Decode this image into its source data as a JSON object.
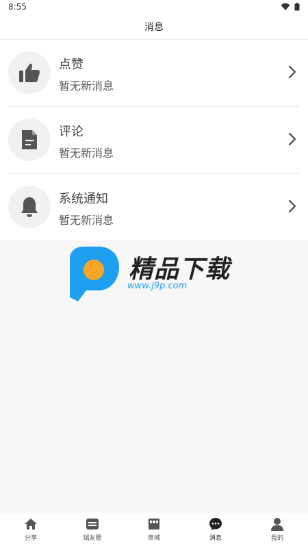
{
  "status": {
    "time": "8:55"
  },
  "header": {
    "title": "消息"
  },
  "rows": [
    {
      "title": "点赞",
      "subtitle": "暂无新消息",
      "icon": "thumbs-up-icon"
    },
    {
      "title": "评论",
      "subtitle": "暂无新消息",
      "icon": "document-icon"
    },
    {
      "title": "系统通知",
      "subtitle": "暂无新消息",
      "icon": "bell-icon"
    }
  ],
  "watermark": {
    "text": "精品下载",
    "url": "www.j9p.com"
  },
  "tabbar": {
    "items": [
      {
        "label": "分享",
        "icon": "home-icon"
      },
      {
        "label": "瑞友圈",
        "icon": "circle-feed-icon"
      },
      {
        "label": "商城",
        "icon": "store-icon"
      },
      {
        "label": "消息",
        "icon": "chat-bubble-icon",
        "active": true
      },
      {
        "label": "我的",
        "icon": "profile-icon"
      }
    ]
  },
  "colors": {
    "accent": "#1f9ff0",
    "icon": "#555555",
    "background": "#f7f7f7"
  }
}
